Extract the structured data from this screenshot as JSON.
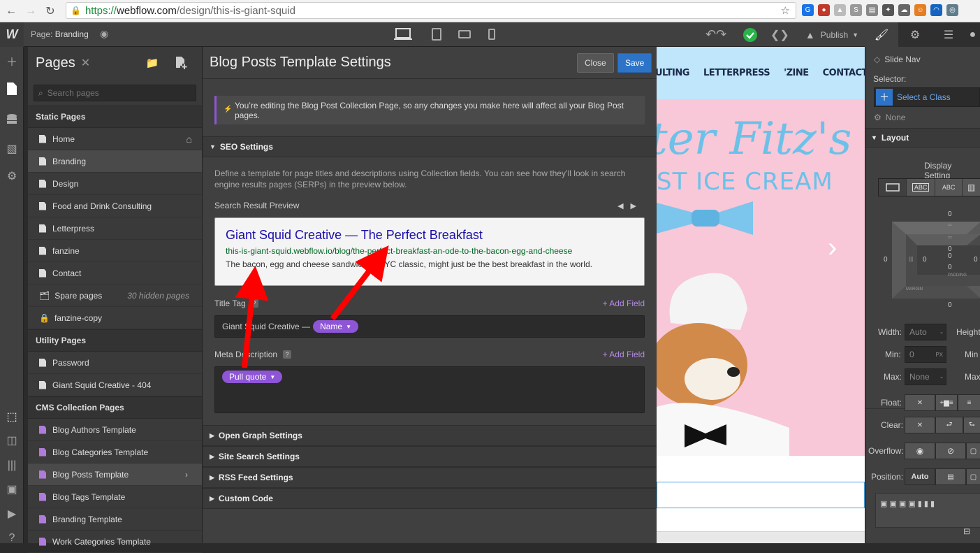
{
  "browser": {
    "url_scheme": "https://",
    "url_host": "webflow.com",
    "url_path": "/design/this-is-giant-squid"
  },
  "topbar": {
    "page_prefix": "Page:",
    "page_name": "Branding",
    "publish_label": "Publish"
  },
  "pages_panel": {
    "title": "Pages",
    "search_placeholder": "Search pages",
    "sections": {
      "static": "Static Pages",
      "utility": "Utility Pages",
      "cms": "CMS Collection Pages"
    },
    "static_pages": [
      "Home",
      "Branding",
      "Design",
      "Food and Drink Consulting",
      "Letterpress",
      "fanzine",
      "Contact"
    ],
    "spare": {
      "label": "Spare pages",
      "meta": "30 hidden pages"
    },
    "fanzine_copy": "fanzine-copy",
    "utility_pages": [
      "Password",
      "Giant Squid Creative - 404"
    ],
    "cms_pages": [
      "Blog Authors Template",
      "Blog Categories Template",
      "Blog Posts Template",
      "Blog Tags Template",
      "Branding Template",
      "Work Categories Template"
    ]
  },
  "settings": {
    "title": "Blog Posts Template Settings",
    "close_label": "Close",
    "save_label": "Save",
    "notice": "You’re editing the Blog Post Collection Page, so any changes you make here will affect all your Blog Post pages.",
    "seo_title": "SEO Settings",
    "seo_description": "Define a template for page titles and descriptions using Collection fields. You can see how they’ll look in search engine results pages (SERPs) in the preview below.",
    "preview_label": "Search Result Preview",
    "preview": {
      "title": "Giant Squid Creative — The Perfect Breakfast",
      "url": "this-is-giant-squid.webflow.io/blog/the-perfect-breakfast-an-ode-to-the-bacon-egg-and-cheese",
      "description": "The bacon, egg and cheese sandwich, a NYC classic, might just be the best breakfast in the world."
    },
    "title_tag_label": "Title Tag",
    "add_field_label": "+ Add Field",
    "title_tag_prefix": "Giant Squid Creative —",
    "title_tag_chip": "Name",
    "meta_label": "Meta Description",
    "meta_chip": "Pull quote",
    "accordions": [
      "Open Graph Settings",
      "Site Search Settings",
      "RSS Feed Settings",
      "Custom Code"
    ]
  },
  "canvas": {
    "nav": [
      "ULTING",
      "LETTERPRESS",
      "'ZINE",
      "CONTACT"
    ],
    "script_text": "ter Fitz's",
    "subtitle": "ST ICE CREAM"
  },
  "style_panel": {
    "element": "Slide Nav",
    "selector_label": "Selector:",
    "select_class": "Select a Class",
    "none_label": "None",
    "layout_title": "Layout",
    "display_setting": "Display Setting",
    "display_opts": [
      "ABC",
      "ABC"
    ],
    "spacing": {
      "margin_top": "0",
      "padding_top": "0",
      "left_outer": "0",
      "left_inner": "0",
      "center": "0",
      "right_inner": "0",
      "bottom_inner": "0",
      "margin_bottom": "0",
      "padding_label": "PADDING",
      "margin_label": "MARGIN"
    },
    "width_label": "Width:",
    "width_value": "Auto",
    "height_label": "Height",
    "min_label": "Min:",
    "min_value": "0",
    "min_unit": "PX",
    "min2_label": "Min",
    "max_label": "Max:",
    "max_value": "None",
    "max2_label": "Max",
    "float_label": "Float:",
    "clear_label": "Clear:",
    "overflow_label": "Overflow:",
    "position_label": "Position:",
    "position_value": "Auto"
  },
  "colors": {
    "accent": "#8e55d6",
    "save": "#2d73c7",
    "link": "#1a0dab",
    "arrow": "#ff0000"
  }
}
